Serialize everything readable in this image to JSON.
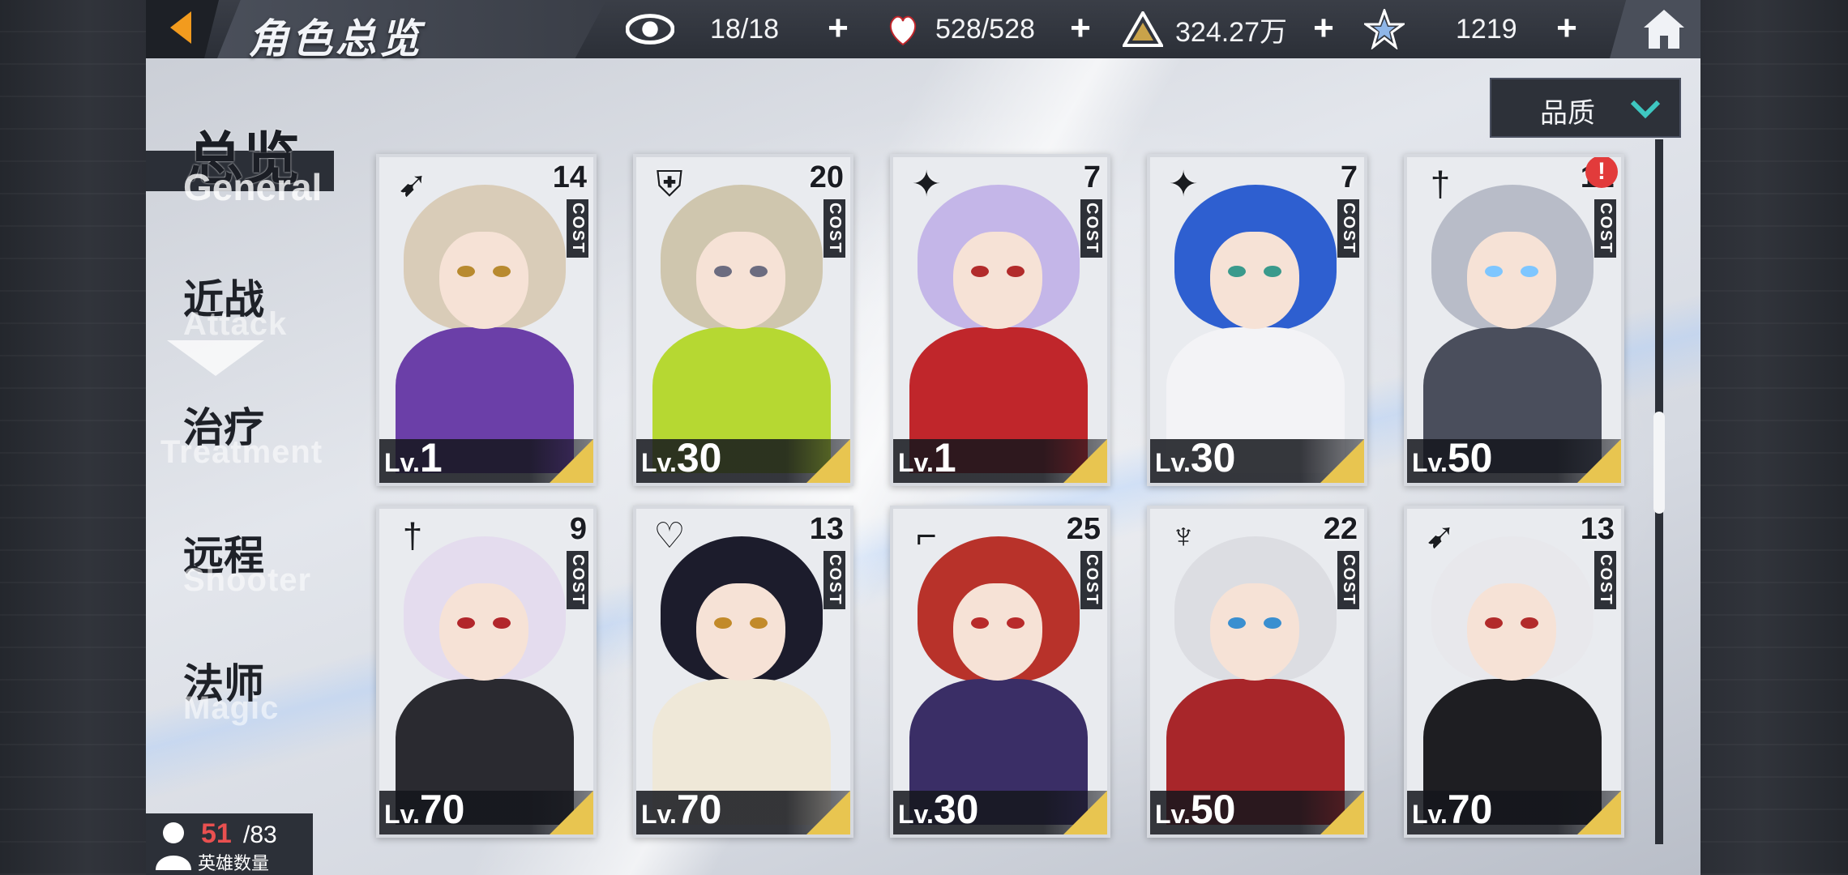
{
  "header": {
    "title": "角色总览",
    "resources": [
      {
        "icon": "eye-icon",
        "value": "18/18"
      },
      {
        "icon": "heart-icon",
        "value": "528/528"
      },
      {
        "icon": "triangle-gold-icon",
        "value": "324.27万"
      },
      {
        "icon": "star-crystal-icon",
        "value": "1219"
      }
    ],
    "plus_label": "+"
  },
  "sort": {
    "label": "品质"
  },
  "nav": [
    {
      "cn": "总览",
      "en": "General",
      "active": true
    },
    {
      "cn": "近战",
      "en": "Attack"
    },
    {
      "cn": "治疗",
      "en": "Treatment"
    },
    {
      "cn": "远程",
      "en": "Shooter"
    },
    {
      "cn": "法师",
      "en": "Magic"
    }
  ],
  "cost_label": "COST",
  "lv_prefix": "Lv.",
  "cards": [
    {
      "cost": "14",
      "lv": "1",
      "class_icon": "bow-icon",
      "hair": "#d9ccb8",
      "outfit": "#6b3fa8",
      "eye": "#b88a2f"
    },
    {
      "cost": "20",
      "lv": "30",
      "class_icon": "shield-icon",
      "hair": "#cfc6ae",
      "outfit": "#b6d832",
      "eye": "#6c6c80"
    },
    {
      "cost": "7",
      "lv": "1",
      "class_icon": "shuriken-icon",
      "hair": "#c4b6e8",
      "outfit": "#c0262b",
      "eye": "#b22b2b"
    },
    {
      "cost": "7",
      "lv": "30",
      "class_icon": "shuriken-icon",
      "hair": "#2e5fd0",
      "outfit": "#f3f3f6",
      "eye": "#3a9a8c"
    },
    {
      "cost": "12",
      "lv": "50",
      "class_icon": "sword-icon",
      "hair": "#b8bcc8",
      "outfit": "#4a4e5c",
      "eye": "#7ec6ff",
      "alert": "!"
    },
    {
      "cost": "9",
      "lv": "70",
      "class_icon": "sword-icon",
      "hair": "#e4dcee",
      "outfit": "#2a2a30",
      "eye": "#b2262b"
    },
    {
      "cost": "13",
      "lv": "70",
      "class_icon": "heart-wing-icon",
      "hair": "#1c1c2c",
      "outfit": "#efe8d8",
      "eye": "#c28a2a"
    },
    {
      "cost": "25",
      "lv": "30",
      "class_icon": "revolver-icon",
      "hair": "#b8322a",
      "outfit": "#3a2e66",
      "eye": "#b82a2a"
    },
    {
      "cost": "22",
      "lv": "50",
      "class_icon": "demon-icon",
      "hair": "#dcdde2",
      "outfit": "#a8262a",
      "eye": "#3a8fd0"
    },
    {
      "cost": "13",
      "lv": "70",
      "class_icon": "bow-icon",
      "hair": "#e8e8ec",
      "outfit": "#1e1e22",
      "eye": "#b22b2b"
    }
  ],
  "hero_count": {
    "current": "51",
    "max": "/83",
    "label": "英雄数量"
  },
  "colors": {
    "accent": "#f29b1e",
    "level_corner": "#e8c550",
    "alert": "#e23b3b"
  }
}
